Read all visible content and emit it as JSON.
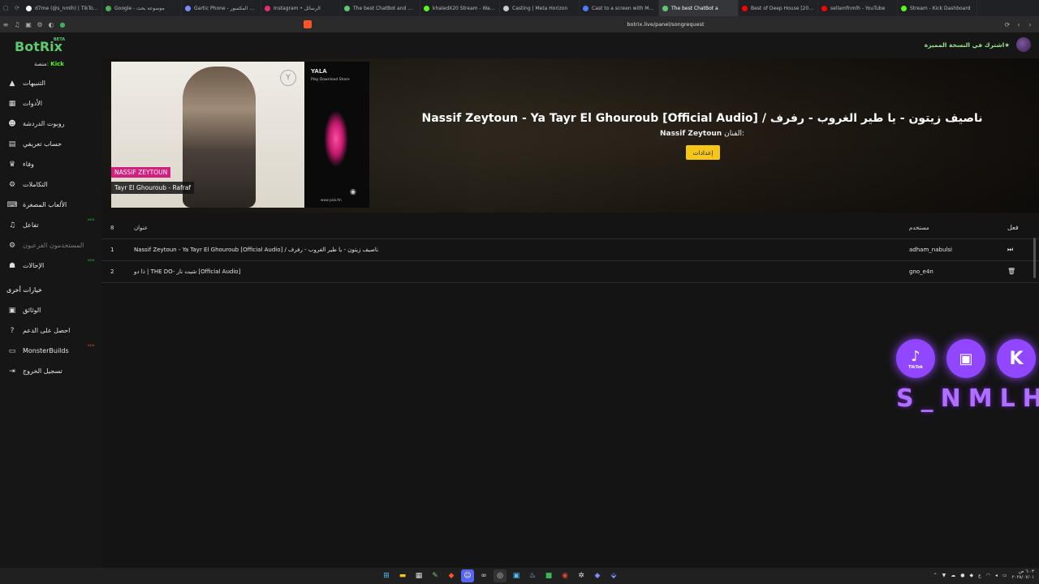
{
  "browser": {
    "tabs": [
      {
        "title": "d7me (@s_nmlh) | TikTok(5)",
        "color": "#ffffff",
        "active": false
      },
      {
        "title": "Google - موسوعة بحث",
        "color": "#4caf50",
        "active": false
      },
      {
        "title": "Gartic Phone - الهاتف المكسور",
        "color": "#7b8cff",
        "active": false
      },
      {
        "title": "Instagram • الرسائل",
        "color": "#e1306c",
        "active": false
      },
      {
        "title": "The best ChatBot and Widg...",
        "color": "#5ec96f",
        "active": false
      },
      {
        "title": "khaledX20 Stream - Watch",
        "color": "#53fc18",
        "active": false
      },
      {
        "title": "Casting | Meta Horizon",
        "color": "#cccccc",
        "active": false
      },
      {
        "title": "Cast to a screen with Meta",
        "color": "#4a7dff",
        "active": false
      },
      {
        "title": "The best ChatBot a",
        "color": "#5ec96f",
        "active": true
      },
      {
        "title": "Best of Deep House [2025]",
        "color": "#ff0000",
        "active": false
      },
      {
        "title": "sellamfnmlh - YouTube",
        "color": "#ff0000",
        "active": false
      },
      {
        "title": "Stream - Kick Dashboard",
        "color": "#53fc18",
        "active": false
      }
    ],
    "url": "botrix.live/panel/songrequest"
  },
  "sidebar": {
    "logo": "BotRix",
    "beta": "BETA",
    "platform_label": "منصة:",
    "platform_value": "Kick",
    "items": [
      {
        "label": "التنبيهات",
        "icon": "warning-icon",
        "glyph": "▲",
        "badge": "",
        "dim": false
      },
      {
        "label": "الأدوات",
        "icon": "tools-icon",
        "glyph": "▦",
        "badge": "",
        "dim": false
      },
      {
        "label": "روبوت الدردشة",
        "icon": "chatbot-icon",
        "glyph": "☻",
        "badge": "",
        "dim": false
      },
      {
        "label": "حساب تعريفي",
        "icon": "profile-card-icon",
        "glyph": "▤",
        "badge": "",
        "dim": false
      },
      {
        "label": "وفاء",
        "icon": "trophy-icon",
        "glyph": "♛",
        "badge": "",
        "dim": false
      },
      {
        "label": "التكاملات",
        "icon": "integrations-icon",
        "glyph": "⚙",
        "badge": "",
        "dim": false
      },
      {
        "label": "الألعاب المصغرة",
        "icon": "gamepad-icon",
        "glyph": "⌨",
        "badge": "",
        "dim": false
      },
      {
        "label": "تفاعل",
        "icon": "music-icon",
        "glyph": "♫",
        "badge": "NEW",
        "dim": false
      },
      {
        "label": "المستخدمون الفرعيون",
        "icon": "user-cog-icon",
        "glyph": "⚙",
        "badge": "",
        "dim": true
      },
      {
        "label": "الإحالات",
        "icon": "users-icon",
        "glyph": "☗",
        "badge": "NEW",
        "dim": false
      }
    ],
    "section_other": "خيارات أخرى",
    "other_items": [
      {
        "label": "الوثائق",
        "icon": "book-icon",
        "glyph": "▣",
        "badge": "",
        "red": false
      },
      {
        "label": "احصل على الدعم",
        "icon": "help-icon",
        "glyph": "?",
        "badge": "",
        "red": false
      },
      {
        "label": "MonsterBuilds",
        "icon": "laptop-icon",
        "glyph": "▭",
        "badge": "NEW",
        "red": true
      },
      {
        "label": "تسجيل الخروج",
        "icon": "logout-icon",
        "glyph": "⇥",
        "badge": "",
        "red": false
      }
    ]
  },
  "topbar": {
    "premium": "اشترك في النسخة المميزة★"
  },
  "hero": {
    "title": "Nassif Zeytoun - Ya Tayr El Ghouroub [Official Audio] / ناصيف زيتون - يا طير الغروب - رفرف",
    "artist_label": "الفنان:",
    "artist": "Nassif Zeytoun",
    "settings_button": "إعدادات",
    "cover": {
      "tag1": "NASSIF ZEYTOUN",
      "tag2": "Tayr El Ghouroub - Rafraf",
      "brand": "YALA",
      "brand_sub": "Play Download Share",
      "url": "www.yala.fm"
    }
  },
  "table": {
    "headers": {
      "num": "8",
      "title": "عنوان",
      "user": "مستخدم",
      "action": "فعل"
    },
    "rows": [
      {
        "num": "1",
        "title": "Nassif Zeytoun - Ya Tayr El Ghouroub [Official Audio] / ناصيف زيتون - يا طير الغروب - رفرف",
        "user": "adham_nabulsi",
        "action_icon": "skip-icon",
        "glyph": "⏭"
      },
      {
        "num": "2",
        "title": "ذا دو | THE DO- شيت نار [Official Audio]",
        "user": "gno_e4n",
        "action_icon": "trash-icon",
        "glyph": "🗑"
      }
    ]
  },
  "overlay": {
    "handle": "S_NMLH",
    "tiktok_label": "TikTok",
    "icons": [
      "tiktok-icon",
      "twitch-icon",
      "kick-icon"
    ]
  },
  "taskbar": {
    "clock_time": "٦:٠٣ ص",
    "clock_date": "٢٠٢٨/٠٧/٠١",
    "lang": "ع"
  }
}
